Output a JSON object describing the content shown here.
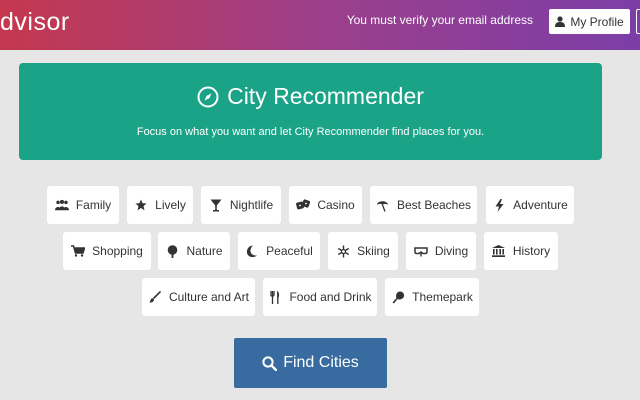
{
  "header": {
    "brand": "dvisor",
    "verify_notice": "You must verify your email address",
    "profile_label": "My Profile"
  },
  "hero": {
    "title": "City Recommender",
    "subtitle": "Focus on what you want and let City Recommender find places for you."
  },
  "categories": [
    {
      "label": "Family",
      "icon": "family-icon"
    },
    {
      "label": "Lively",
      "icon": "star-icon"
    },
    {
      "label": "Nightlife",
      "icon": "cocktail-icon"
    },
    {
      "label": "Casino",
      "icon": "dice-icon"
    },
    {
      "label": "Best Beaches",
      "icon": "umbrella-icon"
    },
    {
      "label": "Adventure",
      "icon": "bolt-icon"
    },
    {
      "label": "Shopping",
      "icon": "cart-icon"
    },
    {
      "label": "Nature",
      "icon": "tree-icon"
    },
    {
      "label": "Peaceful",
      "icon": "moon-icon"
    },
    {
      "label": "Skiing",
      "icon": "snowflake-icon"
    },
    {
      "label": "Diving",
      "icon": "diving-mask-icon"
    },
    {
      "label": "History",
      "icon": "museum-icon"
    },
    {
      "label": "Culture and Art",
      "icon": "brush-icon"
    },
    {
      "label": "Food and Drink",
      "icon": "cutlery-icon"
    },
    {
      "label": "Themepark",
      "icon": "balloon-icon"
    }
  ],
  "find_button": {
    "label": "Find Cities"
  }
}
